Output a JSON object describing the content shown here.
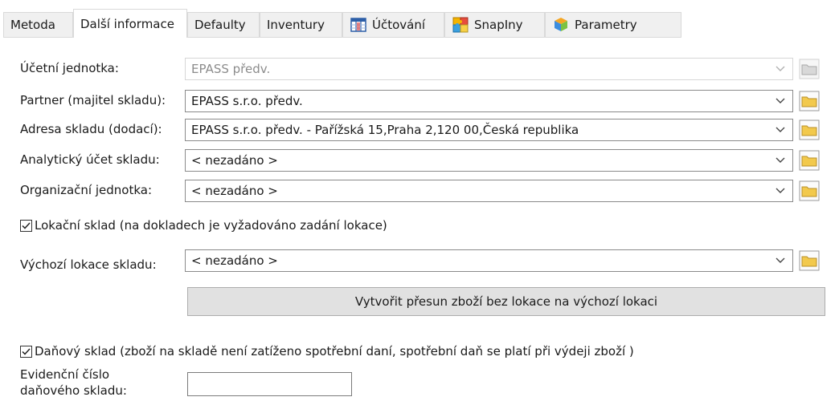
{
  "tabs": [
    {
      "label": "Metoda",
      "icon": null
    },
    {
      "label": "Další informace",
      "icon": null,
      "active": true
    },
    {
      "label": "Defaulty",
      "icon": null
    },
    {
      "label": "Inventury",
      "icon": null
    },
    {
      "label": "Účtování",
      "icon": "grid-table-icon"
    },
    {
      "label": "SnapIny",
      "icon": "puzzle-icon"
    },
    {
      "label": "Parametry",
      "icon": "cubes-icon"
    }
  ],
  "form": {
    "accounting_unit": {
      "label": "Účetní jednotka:",
      "value": "EPASS předv.",
      "disabled": true
    },
    "partner": {
      "label": "Partner (majitel skladu):",
      "value": "EPASS s.r.o. předv."
    },
    "address": {
      "label": "Adresa skladu (dodací):",
      "value": "EPASS s.r.o. předv. - Pařížská 15,Praha 2,120 00,Česká republika"
    },
    "analytic_account": {
      "label": "Analytický účet skladu:",
      "value": "< nezadáno >"
    },
    "org_unit": {
      "label": "Organizační jednotka:",
      "value": "< nezadáno >"
    },
    "location_warehouse": {
      "label": "Lokační sklad (na dokladech je vyžadováno zadání lokace)",
      "checked": true
    },
    "default_location": {
      "label": "Výchozí lokace skladu:",
      "value": "< nezadáno >"
    },
    "move_button": {
      "label": "Vytvořit přesun zboží bez lokace na výchozí lokaci"
    },
    "tax_warehouse": {
      "label": "Daňový sklad (zboží na skladě není zatíženo spotřební daní, spotřební  daň se platí při výdeji zboží )",
      "checked": true
    },
    "tax_number": {
      "label_line1": "Evidenční číslo",
      "label_line2": "daňového skladu:",
      "value": ""
    }
  },
  "colors": {
    "folder_yellow": "#f2c94c",
    "folder_disabled": "#c8c8c8",
    "tab_bg": "#f0f0f0"
  }
}
